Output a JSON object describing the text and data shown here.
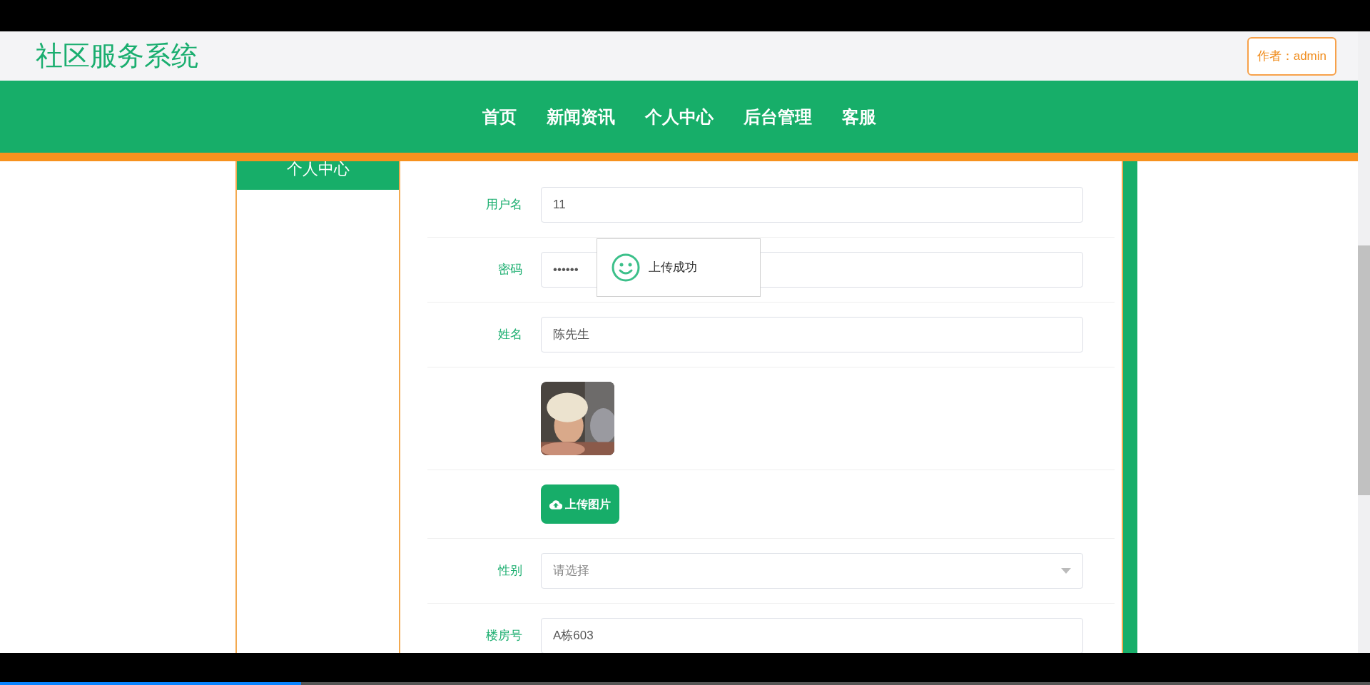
{
  "site_title": "社区服务系统",
  "author_button": "作者：admin",
  "nav": [
    {
      "label": "首页"
    },
    {
      "label": "新闻资讯"
    },
    {
      "label": "个人中心"
    },
    {
      "label": "后台管理"
    },
    {
      "label": "客服"
    }
  ],
  "sidebar": {
    "title": "个人中心"
  },
  "form": [
    {
      "kind": "input",
      "label": "用户名",
      "value": "11"
    },
    {
      "kind": "input",
      "label": "密码",
      "value": "••••••"
    },
    {
      "kind": "input",
      "label": "姓名",
      "value": "陈先生"
    },
    {
      "image": {
        "kind": "picture"
      }
    },
    {
      "kind": "upload",
      "button": "上传图片"
    },
    {
      "kind": "select",
      "label": "性别",
      "placeholder": "请选择"
    },
    {
      "kind": "input",
      "label": "楼房号",
      "value": "A栋603"
    }
  ],
  "toast": {
    "message": "上传成功"
  },
  "video_progress": {
    "level": 0.22
  }
}
